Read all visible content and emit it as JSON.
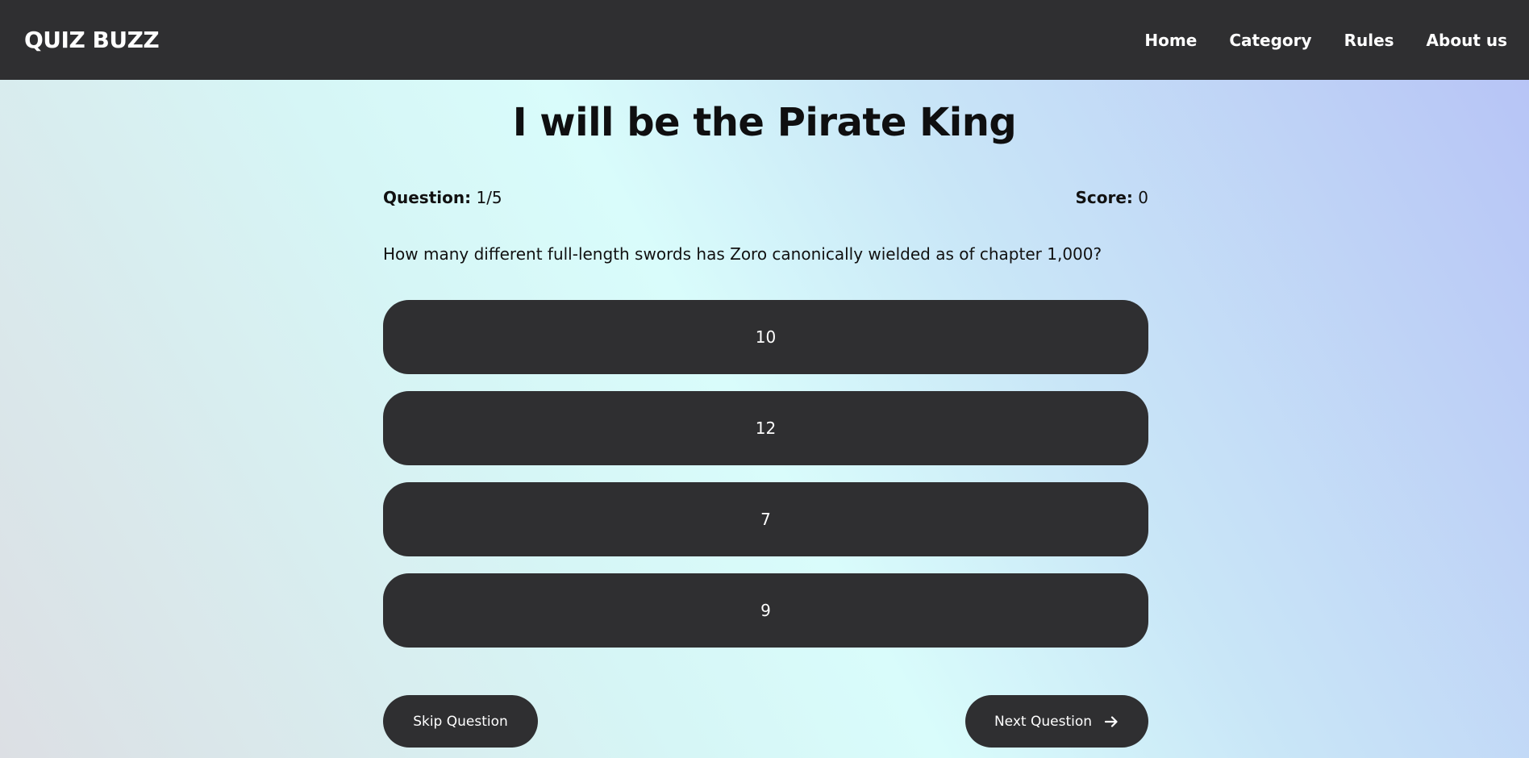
{
  "navbar": {
    "logo": "QUIZ BUZZ",
    "links": [
      "Home",
      "Category",
      "Rules",
      "About us"
    ]
  },
  "quiz": {
    "title": "I will be the Pirate King",
    "question_label": "Question:",
    "question_value": "1/5",
    "score_label": "Score:",
    "score_value": "0",
    "question_text": "How many different full-length swords has Zoro canonically wielded as of chapter 1,000?",
    "answers": [
      "10",
      "12",
      "7",
      "9"
    ]
  },
  "actions": {
    "skip_label": "Skip Question",
    "next_label": "Next Question",
    "next_icon": "arrow-right-icon"
  },
  "colors": {
    "navbar_bg": "#2f2f31",
    "button_bg": "#2f2f31",
    "button_text": "#ffffff"
  }
}
